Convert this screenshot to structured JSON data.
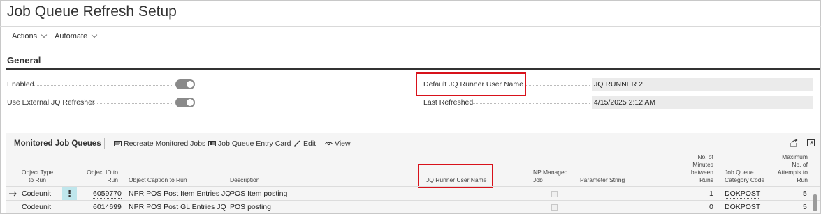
{
  "page": {
    "title": "Job Queue Refresh Setup"
  },
  "menu": {
    "actions_label": "Actions",
    "automate_label": "Automate"
  },
  "general": {
    "section_title": "General",
    "enabled_label": "Enabled",
    "enabled_value": true,
    "use_external_label": "Use External JQ Refresher",
    "use_external_value": true,
    "default_runner_label": "Default JQ Runner User Name",
    "default_runner_value": "JQ RUNNER 2",
    "last_refreshed_label": "Last Refreshed",
    "last_refreshed_value": "4/15/2025 2:12 AM"
  },
  "monitored": {
    "title": "Monitored Job Queues",
    "actions": {
      "recreate": "Recreate Monitored Jobs",
      "entry_card": "Job Queue Entry Card",
      "edit": "Edit",
      "view": "View"
    },
    "columns": {
      "object_type": [
        "Object Type",
        "to Run"
      ],
      "object_id": [
        "Object ID to",
        "Run"
      ],
      "caption": "Object Caption to Run",
      "description": "Description",
      "runner": "JQ Runner User Name",
      "np_managed": [
        "NP Managed",
        "Job"
      ],
      "parameter": "Parameter String",
      "minutes": [
        "No. of",
        "Minutes",
        "between",
        "Runs"
      ],
      "category": [
        "Job Queue",
        "Category Code"
      ],
      "attempts": [
        "Maximum",
        "No. of",
        "Attempts to",
        "Run"
      ]
    },
    "rows": [
      {
        "type": "Codeunit",
        "id": "6059770",
        "caption": "NPR POS Post Item Entries JQ",
        "description": "POS Item posting",
        "runner": "",
        "np_managed": true,
        "parameter": "",
        "minutes": "1",
        "category": "DOKPOST",
        "attempts": "5"
      },
      {
        "type": "Codeunit",
        "id": "6014699",
        "caption": "NPR POS Post GL Entries JQ",
        "description": "POS posting",
        "runner": "",
        "np_managed": true,
        "parameter": "",
        "minutes": "0",
        "category": "DOKPOST",
        "attempts": "5"
      }
    ]
  }
}
